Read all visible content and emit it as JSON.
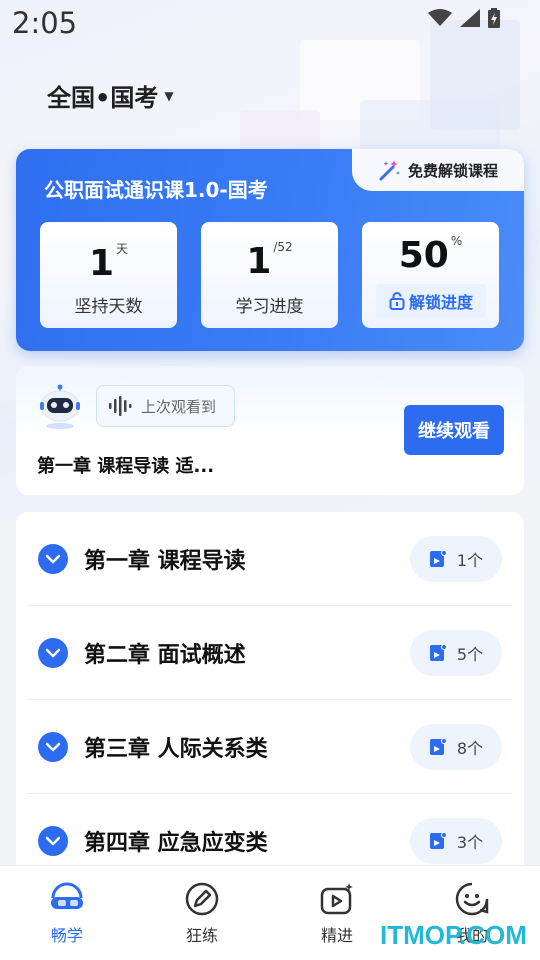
{
  "status_bar": {
    "time": "2:05"
  },
  "header": {
    "region": "全国•国考"
  },
  "course": {
    "title": "公职面试通识课1.0-国考",
    "free_tag": "免费解锁课程",
    "stats": [
      {
        "value": "1",
        "sup": "天",
        "label": "坚持天数"
      },
      {
        "value": "1",
        "sup": "/52",
        "label": "学习进度"
      },
      {
        "value": "50",
        "sup": "%",
        "action": "解锁进度"
      }
    ]
  },
  "resume": {
    "bubble_text": "上次观看到",
    "chapter": "第一章 课程导读 适...",
    "button": "继续观看"
  },
  "chapters": [
    {
      "title": "第一章 课程导读",
      "count": "1个"
    },
    {
      "title": "第二章 面试概述",
      "count": "5个"
    },
    {
      "title": "第三章 人际关系类",
      "count": "8个"
    },
    {
      "title": "第四章 应急应变类",
      "count": "3个"
    }
  ],
  "nav": [
    {
      "label": "畅学",
      "icon": "study-icon",
      "active": true
    },
    {
      "label": "狂练",
      "icon": "pen-icon"
    },
    {
      "label": "精进",
      "icon": "video-icon"
    },
    {
      "label": "我的",
      "icon": "smile-icon"
    }
  ],
  "watermark": "ITMOP.COM",
  "colors": {
    "primary": "#2d6cf0",
    "watermark": "#22b8d8"
  }
}
